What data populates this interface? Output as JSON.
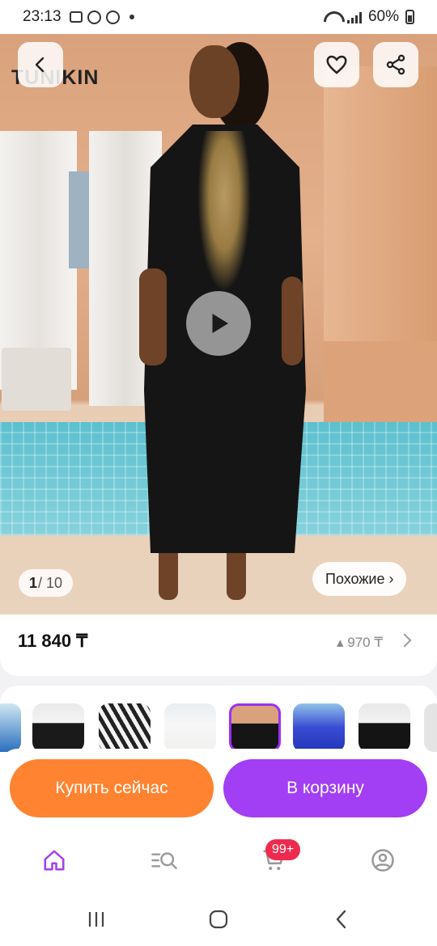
{
  "status_bar": {
    "time": "23:13",
    "battery": "60%"
  },
  "hero": {
    "logo_text": "TUNIKIN",
    "image_index": "1",
    "image_total": "/ 10",
    "similar_label": "Похожие ›",
    "icons": [
      "back-icon",
      "heart-icon",
      "share-icon",
      "play-icon"
    ]
  },
  "price": {
    "current": "11 840 ₸",
    "old": "▴ 970 ₸"
  },
  "thumbnails": {
    "count": 9,
    "selected_index": 4
  },
  "actions": {
    "buy_now": "Купить сейчас",
    "add_to_cart": "В корзину"
  },
  "bottom_nav": {
    "cart_badge": "99+",
    "items": [
      "home-icon",
      "catalog-search-icon",
      "cart-icon",
      "profile-icon"
    ],
    "active": "home-icon"
  },
  "colors": {
    "orange": "#ff8330",
    "purple": "#a23ef3",
    "badge_red": "#ee2b4e",
    "accent": "#9b30f0"
  }
}
